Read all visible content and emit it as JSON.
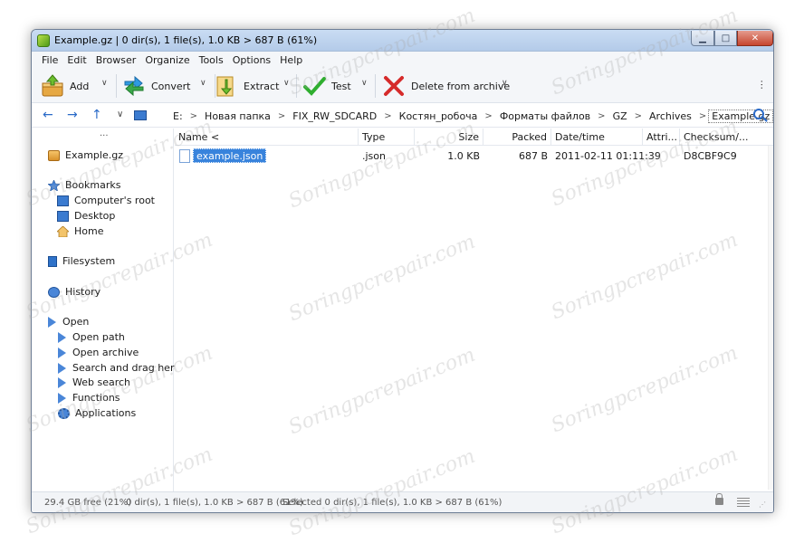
{
  "window": {
    "title": "Example.gz | 0 dir(s), 1 file(s), 1.0 KB > 687 B (61%)",
    "min_glyph": "▁",
    "max_glyph": "□",
    "close_glyph": "✕"
  },
  "menu": [
    "File",
    "Edit",
    "Browser",
    "Organize",
    "Tools",
    "Options",
    "Help"
  ],
  "toolbar": {
    "add": "Add",
    "convert": "Convert",
    "extract": "Extract",
    "test": "Test",
    "delete": "Delete from archive",
    "drop_glyph": "∨",
    "more_glyph": "⋮"
  },
  "address": {
    "back": "←",
    "forward": "→",
    "up": "↑",
    "history_drop": "∨",
    "crumbs": [
      "E:",
      "Новая папка",
      "FIX_RW_SDCARD",
      "Костян_робоча",
      "Форматы файлов",
      "GZ",
      "Archives",
      "Example.gz"
    ],
    "sep": ">"
  },
  "sidebar": {
    "dots": "···",
    "archive": "Example.gz",
    "bookmarks": "Bookmarks",
    "bookmark_items": [
      "Computer's root",
      "Desktop",
      "Home"
    ],
    "filesystem": "Filesystem",
    "history": "History",
    "open": "Open",
    "open_items": [
      "Open path",
      "Open archive",
      "Search and drag here",
      "Web search",
      "Functions",
      "Applications"
    ]
  },
  "table": {
    "columns": [
      "Name <",
      "Type",
      "Size",
      "Packed",
      "Date/time",
      "Attri...",
      "Checksum/..."
    ],
    "rows": [
      {
        "name": "example.json",
        "type": ".json",
        "size": "1.0 KB",
        "packed": "687 B",
        "datetime": "2011-02-11 01:11:39",
        "attr": "",
        "checksum": "D8CBF9C9"
      }
    ]
  },
  "status": {
    "free": "29.4 GB free (21%)",
    "total": "0 dir(s), 1 file(s), 1.0 KB > 687 B (61%)",
    "selected": "Selected 0 dir(s), 1 file(s), 1.0 KB > 687 B (61%)",
    "grip": "⋰"
  },
  "watermark": "Soringpcrepair.com",
  "colors": {
    "selection": "#3883dc",
    "accent": "#2a6ac8"
  }
}
